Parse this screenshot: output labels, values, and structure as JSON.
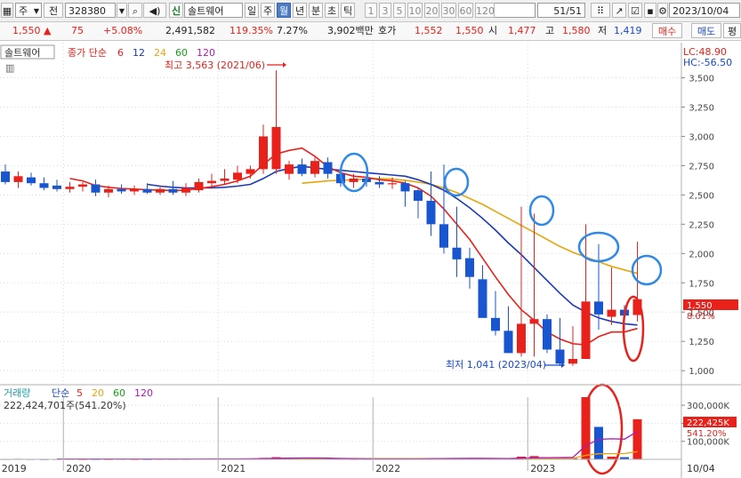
{
  "toolbar": {
    "menu_label": "주",
    "exchange_label": "전",
    "code": "328380",
    "zoom_icon": "magnifier-icon",
    "sound_icon": "speaker-icon",
    "new_badge": "신",
    "stock_name": "솔트웨어",
    "periods": [
      "일",
      "주",
      "월",
      "년",
      "분",
      "초",
      "틱"
    ],
    "active_period": "월",
    "intervals": [
      "1",
      "3",
      "5",
      "10",
      "20",
      "30",
      "60",
      "120"
    ],
    "count": "51",
    "count_total": "/51",
    "date": "2023/10/04"
  },
  "quote": {
    "price": "1,550",
    "arrow": "▲",
    "change": "75",
    "change_pct": "+5.08%",
    "volume": "2,491,582",
    "vol_ratio": "119.35%",
    "turnover": "7.27%",
    "amount": "3,902백만",
    "bid_label": "호가",
    "bid1": "1,552",
    "bid2": "1,550",
    "open_label": "시",
    "open": "1,477",
    "high_label": "고",
    "high": "1,580",
    "low_label": "저",
    "low": "1,419",
    "buy_label": "매수",
    "sell_label": "매도",
    "eval_label": "평"
  },
  "chart_data": [
    {
      "type": "candlestick",
      "title": "솔트웨어",
      "legend_label": "종가 단순",
      "ma_periods": [
        6,
        12,
        24,
        60,
        120
      ],
      "ma_colors": [
        "#e8211b",
        "#1a3ab8",
        "#e8a50c",
        "#18a018",
        "#b018b0"
      ],
      "annotation_high": "최고 3,563 (2021/06)",
      "annotation_low": "최저 1,041 (2023/04)",
      "lc_label": "LC:48.90",
      "hc_label": "HC:-56.50",
      "price_tag": "1,550",
      "pct_tag": "8.01%",
      "ylim": [
        880,
        3800
      ],
      "y_ticks": [
        3500,
        3250,
        3000,
        2750,
        2500,
        2250,
        2000,
        1750,
        1500,
        1250,
        1000
      ],
      "y_tick_labels": [
        "3,500",
        "3,250",
        "3,000",
        "2,750",
        "2,500",
        "2,250",
        "2,000",
        "1,750",
        "1,500",
        "1,250",
        "1,000"
      ],
      "x_labels": [
        {
          "label": "2019",
          "index": -0.5
        },
        {
          "label": "2020",
          "index": 4.5
        },
        {
          "label": "2021",
          "index": 16.5
        },
        {
          "label": "2022",
          "index": 28.5
        },
        {
          "label": "2023",
          "index": 40.5
        },
        {
          "label": "10/04",
          "index": 53.5
        }
      ],
      "candles": [
        {
          "o": 2700,
          "h": 2760,
          "l": 2590,
          "c": 2610
        },
        {
          "o": 2610,
          "h": 2700,
          "l": 2560,
          "c": 2660
        },
        {
          "o": 2650,
          "h": 2690,
          "l": 2580,
          "c": 2600
        },
        {
          "o": 2600,
          "h": 2650,
          "l": 2540,
          "c": 2560
        },
        {
          "o": 2580,
          "h": 2630,
          "l": 2530,
          "c": 2550
        },
        {
          "o": 2550,
          "h": 2610,
          "l": 2520,
          "c": 2570
        },
        {
          "o": 2570,
          "h": 2610,
          "l": 2530,
          "c": 2590
        },
        {
          "o": 2590,
          "h": 2630,
          "l": 2490,
          "c": 2520
        },
        {
          "o": 2520,
          "h": 2580,
          "l": 2480,
          "c": 2550
        },
        {
          "o": 2550,
          "h": 2590,
          "l": 2510,
          "c": 2530
        },
        {
          "o": 2530,
          "h": 2580,
          "l": 2500,
          "c": 2550
        },
        {
          "o": 2550,
          "h": 2600,
          "l": 2510,
          "c": 2520
        },
        {
          "o": 2520,
          "h": 2580,
          "l": 2500,
          "c": 2550
        },
        {
          "o": 2550,
          "h": 2620,
          "l": 2500,
          "c": 2520
        },
        {
          "o": 2520,
          "h": 2600,
          "l": 2490,
          "c": 2560
        },
        {
          "o": 2540,
          "h": 2640,
          "l": 2520,
          "c": 2610
        },
        {
          "o": 2600,
          "h": 2680,
          "l": 2570,
          "c": 2620
        },
        {
          "o": 2620,
          "h": 2720,
          "l": 2590,
          "c": 2640
        },
        {
          "o": 2630,
          "h": 2750,
          "l": 2600,
          "c": 2690
        },
        {
          "o": 2680,
          "h": 2750,
          "l": 2640,
          "c": 2720
        },
        {
          "o": 2720,
          "h": 3100,
          "l": 2680,
          "c": 3000
        },
        {
          "o": 2720,
          "h": 3563,
          "l": 2680,
          "c": 3080
        },
        {
          "o": 2680,
          "h": 2790,
          "l": 2630,
          "c": 2760
        },
        {
          "o": 2760,
          "h": 2810,
          "l": 2660,
          "c": 2680
        },
        {
          "o": 2680,
          "h": 2820,
          "l": 2650,
          "c": 2790
        },
        {
          "o": 2780,
          "h": 2820,
          "l": 2640,
          "c": 2680
        },
        {
          "o": 2680,
          "h": 2720,
          "l": 2570,
          "c": 2600
        },
        {
          "o": 2610,
          "h": 2680,
          "l": 2560,
          "c": 2640
        },
        {
          "o": 2640,
          "h": 2690,
          "l": 2570,
          "c": 2610
        },
        {
          "o": 2610,
          "h": 2660,
          "l": 2560,
          "c": 2590
        },
        {
          "o": 2600,
          "h": 2650,
          "l": 2550,
          "c": 2600
        },
        {
          "o": 2600,
          "h": 2620,
          "l": 2400,
          "c": 2530
        },
        {
          "o": 2540,
          "h": 2560,
          "l": 2300,
          "c": 2450
        },
        {
          "o": 2450,
          "h": 2700,
          "l": 2150,
          "c": 2250
        },
        {
          "o": 2250,
          "h": 2760,
          "l": 2000,
          "c": 2050
        },
        {
          "o": 2050,
          "h": 2400,
          "l": 1800,
          "c": 1950
        },
        {
          "o": 1960,
          "h": 2050,
          "l": 1700,
          "c": 1800
        },
        {
          "o": 1780,
          "h": 1900,
          "l": 1450,
          "c": 1450
        },
        {
          "o": 1450,
          "h": 1680,
          "l": 1300,
          "c": 1340
        },
        {
          "o": 1340,
          "h": 1550,
          "l": 1150,
          "c": 1150
        },
        {
          "o": 1150,
          "h": 2400,
          "l": 1120,
          "c": 1400
        },
        {
          "o": 1400,
          "h": 2340,
          "l": 1120,
          "c": 1440
        },
        {
          "o": 1440,
          "h": 1480,
          "l": 1150,
          "c": 1180
        },
        {
          "o": 1180,
          "h": 1450,
          "l": 1041,
          "c": 1060
        },
        {
          "o": 1060,
          "h": 1380,
          "l": 1041,
          "c": 1100
        },
        {
          "o": 1100,
          "h": 2250,
          "l": 1100,
          "c": 1590
        },
        {
          "o": 1590,
          "h": 2080,
          "l": 1350,
          "c": 1480
        },
        {
          "o": 1460,
          "h": 1880,
          "l": 1390,
          "c": 1520
        },
        {
          "o": 1520,
          "h": 1560,
          "l": 1350,
          "c": 1470
        },
        {
          "o": 1475,
          "h": 2100,
          "l": 1419,
          "c": 1610
        }
      ],
      "ma6": [
        null,
        null,
        null,
        null,
        null,
        2640,
        2620,
        2580,
        2565,
        2555,
        2550,
        2545,
        2540,
        2538,
        2540,
        2555,
        2570,
        2590,
        2620,
        2660,
        2760,
        2850,
        2880,
        2900,
        2830,
        2740,
        2690,
        2660,
        2650,
        2630,
        2620,
        2600,
        2560,
        2490,
        2380,
        2250,
        2120,
        1960,
        1800,
        1650,
        1520,
        1430,
        1330,
        1270,
        1230,
        1220,
        1290,
        1330,
        1330,
        1360
      ],
      "ma12": [
        null,
        null,
        null,
        null,
        null,
        null,
        null,
        null,
        null,
        null,
        null,
        2590,
        2575,
        2565,
        2560,
        2560,
        2560,
        2565,
        2575,
        2590,
        2640,
        2700,
        2725,
        2745,
        2730,
        2720,
        2710,
        2700,
        2690,
        2680,
        2670,
        2660,
        2630,
        2590,
        2540,
        2470,
        2390,
        2300,
        2200,
        2090,
        1990,
        1880,
        1770,
        1660,
        1560,
        1500,
        1450,
        1420,
        1400,
        1390
      ],
      "ma24": [
        null,
        null,
        null,
        null,
        null,
        null,
        null,
        null,
        null,
        null,
        null,
        null,
        null,
        null,
        null,
        null,
        null,
        null,
        null,
        null,
        null,
        null,
        null,
        2600,
        2610,
        2620,
        2625,
        2630,
        2635,
        2640,
        2635,
        2625,
        2610,
        2590,
        2560,
        2520,
        2470,
        2420,
        2360,
        2300,
        2240,
        2180,
        2120,
        2060,
        2010,
        1970,
        1930,
        1890,
        1860,
        1830
      ]
    },
    {
      "type": "bar",
      "title": "거래량",
      "legend_label": "단순",
      "ma_periods": [
        5,
        20,
        60,
        120
      ],
      "ma_colors": [
        "#e8211b",
        "#e8a50c",
        "#18a018",
        "#b018b0"
      ],
      "stat_text": "222,424,701주(541.20%)",
      "volume_tag": "222,425K",
      "pct_tag": "541.20%",
      "ylim": [
        0,
        345000
      ],
      "y_ticks": [
        300000,
        200000,
        100000
      ],
      "y_tick_labels": [
        "300,000K",
        "200,000K",
        "100,000K"
      ],
      "values": [
        2000,
        3000,
        2000,
        1500,
        2000,
        2000,
        1500,
        1500,
        1500,
        2000,
        1500,
        1500,
        2000,
        2000,
        2000,
        3000,
        2500,
        3000,
        3000,
        4000,
        8000,
        12000,
        6000,
        7000,
        5000,
        4000,
        3000,
        2000,
        2000,
        2500,
        3000,
        2500,
        4000,
        6000,
        7000,
        5000,
        5000,
        3000,
        4000,
        4000,
        15000,
        18000,
        8000,
        5000,
        6000,
        345000,
        180000,
        15000,
        12000,
        222424
      ],
      "ma5": [
        null,
        null,
        null,
        null,
        2100,
        2100,
        1800,
        1700,
        1600,
        1700,
        1600,
        1600,
        1700,
        1800,
        1900,
        2100,
        2300,
        2500,
        2700,
        3100,
        4100,
        6000,
        6600,
        7400,
        7600,
        6600,
        5000,
        4200,
        3200,
        2700,
        2500,
        2500,
        2700,
        3400,
        4500,
        5000,
        5400,
        5200,
        4800,
        4200,
        6200,
        8800,
        9600,
        10000,
        10400,
        76400,
        111000,
        114000,
        112000,
        155000
      ],
      "ma20": [
        null,
        null,
        null,
        null,
        null,
        null,
        null,
        null,
        null,
        null,
        null,
        null,
        null,
        null,
        null,
        null,
        null,
        null,
        null,
        2200,
        2500,
        3000,
        3200,
        3500,
        3700,
        3800,
        3900,
        3950,
        4000,
        4050,
        4100,
        4100,
        4150,
        4300,
        4450,
        4500,
        4550,
        4550,
        4600,
        4600,
        4950,
        5300,
        5400,
        5450,
        5500,
        22300,
        31100,
        31600,
        32000,
        43000
      ],
      "ma60": [
        null,
        null,
        null,
        null,
        null,
        null,
        null,
        null,
        null,
        null,
        null,
        null,
        null,
        null,
        null,
        null,
        null,
        null,
        null,
        null,
        null,
        null,
        null,
        null,
        null,
        null,
        null,
        null,
        null,
        null,
        null,
        null,
        null,
        null,
        null,
        null,
        null,
        null,
        null,
        null,
        null,
        null,
        null,
        null,
        null,
        null,
        null,
        null,
        null,
        20000
      ],
      "ma120": []
    }
  ]
}
